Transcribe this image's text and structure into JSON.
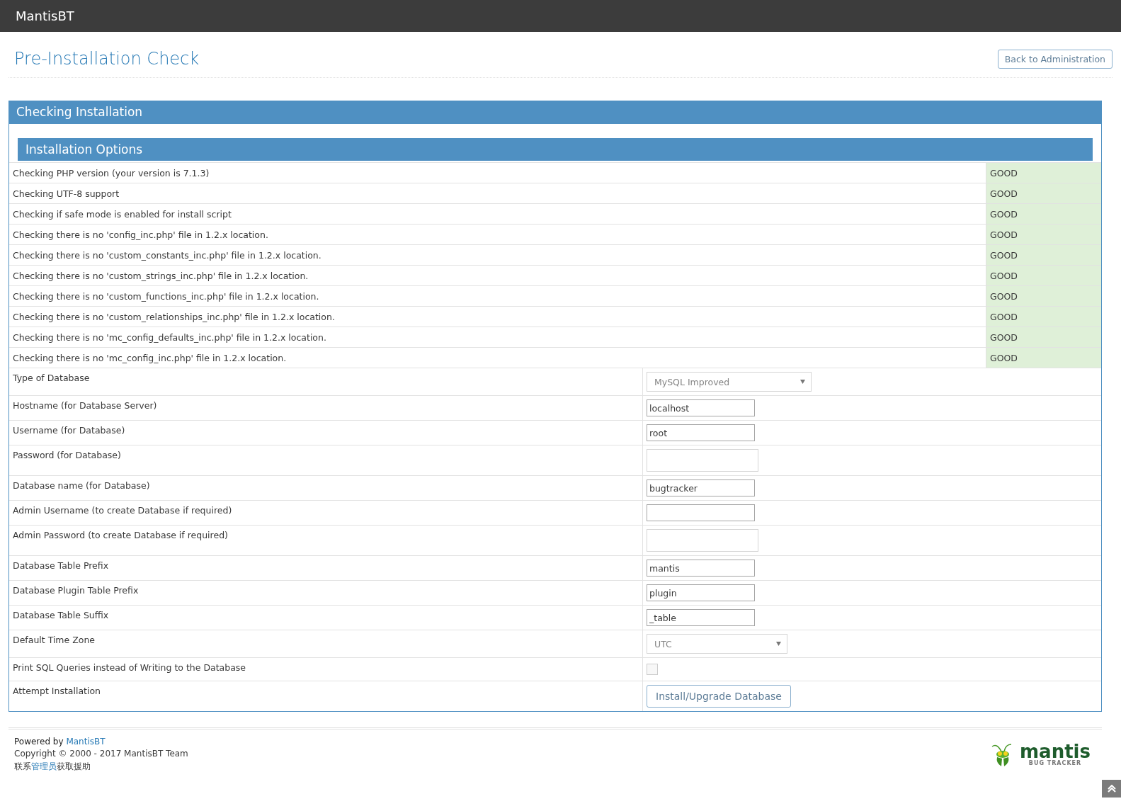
{
  "navbar": {
    "brand": "MantisBT"
  },
  "page": {
    "title": "Pre-Installation Check",
    "back_button": "Back to Administration"
  },
  "panel": {
    "title": "Checking Installation",
    "section_title": "Installation Options"
  },
  "checks": [
    {
      "label": "Checking PHP version (your version is 7.1.3)",
      "result": "GOOD",
      "passed": true
    },
    {
      "label": "Checking UTF-8 support",
      "result": "GOOD",
      "passed": true
    },
    {
      "label": "Checking if safe mode is enabled for install script",
      "result": "GOOD",
      "passed": true
    },
    {
      "label": "Checking there is no 'config_inc.php' file in 1.2.x location.",
      "result": "GOOD",
      "passed": true
    },
    {
      "label": "Checking there is no 'custom_constants_inc.php' file in 1.2.x location.",
      "result": "GOOD",
      "passed": true
    },
    {
      "label": "Checking there is no 'custom_strings_inc.php' file in 1.2.x location.",
      "result": "GOOD",
      "passed": true
    },
    {
      "label": "Checking there is no 'custom_functions_inc.php' file in 1.2.x location.",
      "result": "GOOD",
      "passed": true
    },
    {
      "label": "Checking there is no 'custom_relationships_inc.php' file in 1.2.x location.",
      "result": "GOOD",
      "passed": true
    },
    {
      "label": "Checking there is no 'mc_config_defaults_inc.php' file in 1.2.x location.",
      "result": "GOOD",
      "passed": true
    },
    {
      "label": "Checking there is no 'mc_config_inc.php' file in 1.2.x location.",
      "result": "GOOD",
      "passed": true
    }
  ],
  "options": [
    {
      "kind": "select",
      "label": "Type of Database",
      "value": "MySQL Improved"
    },
    {
      "kind": "text",
      "label": "Hostname (for Database Server)",
      "value": "localhost"
    },
    {
      "kind": "text",
      "label": "Username (for Database)",
      "value": "root"
    },
    {
      "kind": "password",
      "label": "Password (for Database)"
    },
    {
      "kind": "text",
      "label": "Database name (for Database)",
      "value": "bugtracker"
    },
    {
      "kind": "text",
      "label": "Admin Username (to create Database if required)"
    },
    {
      "kind": "password",
      "label": "Admin Password (to create Database if required)"
    },
    {
      "kind": "text",
      "label": "Database Table Prefix",
      "value": "mantis"
    },
    {
      "kind": "text",
      "label": "Database Plugin Table Prefix",
      "value": "plugin"
    },
    {
      "kind": "text",
      "label": "Database Table Suffix",
      "value": "_table"
    },
    {
      "kind": "select",
      "label": "Default Time Zone",
      "value": "UTC"
    },
    {
      "kind": "checkbox",
      "label": "Print SQL Queries instead of Writing to the Database",
      "checked": false
    },
    {
      "kind": "button",
      "label": "Attempt Installation",
      "value": "Install/Upgrade Database"
    }
  ],
  "footer": {
    "powered_prefix": "Powered by",
    "powered_link": "MantisBT",
    "copyright": "Copyright © 2000 - 2017 MantisBT Team",
    "contact_before": "联系",
    "contact_link": "管理员",
    "contact_after": "获取援助",
    "logo_name": "mantis",
    "logo_tagline": "BUG TRACKER"
  }
}
